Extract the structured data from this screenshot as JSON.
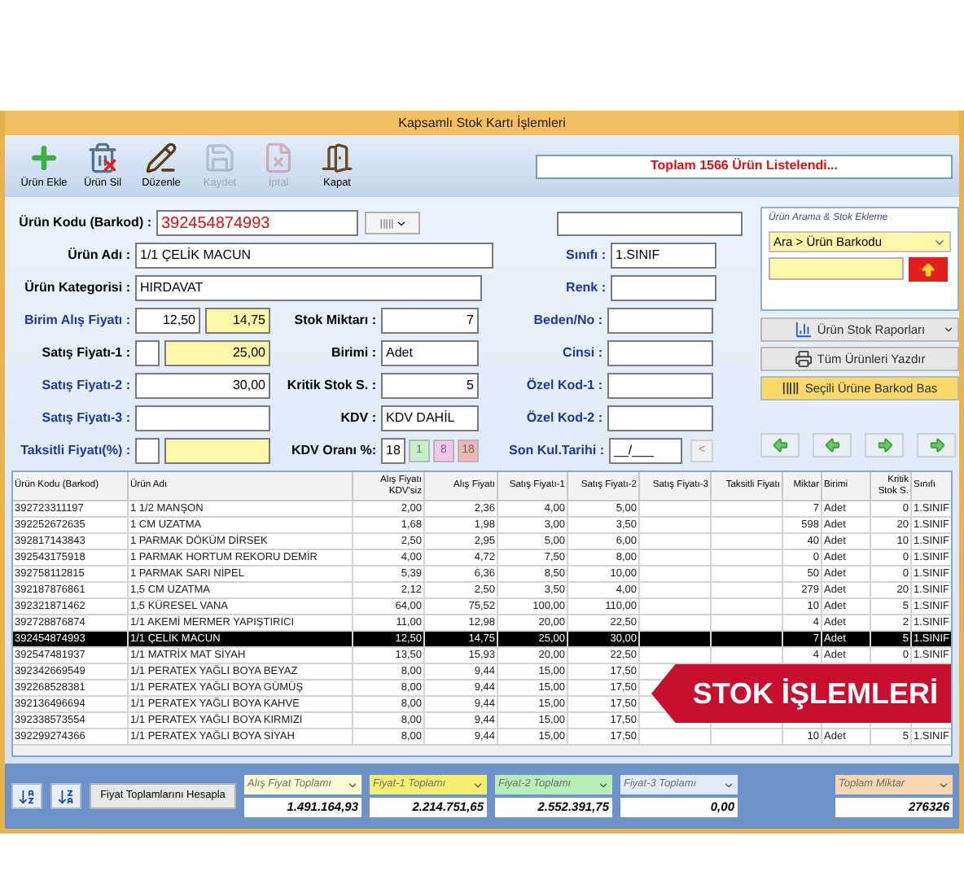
{
  "window": {
    "title": "Kapsamlı Stok Kartı İşlemleri"
  },
  "toolbar": [
    {
      "label": "Ürün Ekle",
      "kind": "add",
      "disabled": false
    },
    {
      "label": "Ürün Sil",
      "kind": "delete",
      "disabled": false
    },
    {
      "label": "Düzenle",
      "kind": "edit",
      "disabled": false
    },
    {
      "label": "Kaydet",
      "kind": "save",
      "disabled": true
    },
    {
      "label": "İptal",
      "kind": "cancel",
      "disabled": true
    },
    {
      "label": "Kapat",
      "kind": "close",
      "disabled": false
    }
  ],
  "status": "Toplam 1566 Ürün Listelendi...",
  "form": {
    "product_code": {
      "label": "Ürün Kodu (Barkod) :",
      "value": "392454874993",
      "color": "#000000"
    },
    "product_name": {
      "label": "Ürün Adı :",
      "value": "1/1 ÇELİK MACUN",
      "color": "#000000"
    },
    "category": {
      "label": "Ürün Kategorisi :",
      "value": "HIRDAVAT",
      "color": "#000000"
    },
    "purchase_price": {
      "label": "Birim Alış Fiyatı :",
      "value": "12,50",
      "value_with_vat": "14,75",
      "color": "#1f35a8"
    },
    "sale_price_1": {
      "label": "Satış Fiyatı-1 :",
      "value": "25,00",
      "color": "#000000"
    },
    "sale_price_2": {
      "label": "Satış Fiyatı-2 :",
      "value": "30,00",
      "color": "#1f35a8"
    },
    "sale_price_3": {
      "label": "Satış Fiyatı-3 :",
      "color": "#1f35a8"
    },
    "installment_price": {
      "label": "Taksitli Fiyatı(%) :",
      "color": "#1f35a8"
    },
    "stock_quantity": {
      "label": "Stok Miktarı :",
      "value": "7",
      "color": "#000000"
    },
    "unit": {
      "label": "Birimi :",
      "value": "Adet",
      "color": "#000000"
    },
    "critical_stock": {
      "label": "Kritik Stok S. :",
      "value": "5",
      "color": "#000000"
    },
    "vat": {
      "label": "KDV :",
      "value": "KDV DAHİL",
      "color": "#000000"
    },
    "vat_rate": {
      "label": "KDV Oranı %:",
      "value": "18",
      "options": [
        {
          "label": "1",
          "color": "#c6f0c6"
        },
        {
          "label": "8",
          "color": "#f2c6f0"
        },
        {
          "label": "18",
          "color": "#f2b4b4"
        }
      ],
      "color": "#000000"
    },
    "class": {
      "label": "Sınıfı :",
      "value": "1.SINIF",
      "color": "#1f35a8"
    },
    "colour": {
      "label": "Renk :",
      "color": "#1f35a8"
    },
    "size": {
      "label": "Beden/No :",
      "color": "#1f35a8"
    },
    "type": {
      "label": "Cinsi :",
      "color": "#1f35a8"
    },
    "special_code_1": {
      "label": "Özel Kod-1 :",
      "color": "#1f35a8"
    },
    "special_code_2": {
      "label": "Özel Kod-2 :",
      "color": "#1f35a8"
    },
    "expiry_date": {
      "label": "Son Kul.Tarihi :",
      "value": "__/___",
      "button": "<",
      "color": "#1f35a8"
    }
  },
  "search": {
    "title": "Ürün Arama & Stok Ekleme",
    "mode": "Ara > Ürün Barkodu"
  },
  "actions": [
    {
      "label": "Ürün Stok Raporları",
      "kind": "report"
    },
    {
      "label": "Tüm Ürünleri Yazdır",
      "kind": "print"
    },
    {
      "label": "Seçili Ürüne Barkod Bas",
      "kind": "barcode"
    }
  ],
  "table": {
    "columns": [
      "Ürün Kodu (Barkod)",
      "Ürün Adı",
      "Alış Fiyatı KDV'siz",
      "Alış Fiyatı",
      "Satış Fiyatı-1",
      "Satış Fiyatı-2",
      "Satış Fiyatı-3",
      "Taksitli Fiyatı",
      "Miktar",
      "Birimi",
      "Kritik Stok S.",
      "Sınıfı"
    ],
    "rows": [
      {
        "selected": false,
        "cells": [
          "392723311197",
          "1 1/2 MANŞON",
          "2,00",
          "2,36",
          "4,00",
          "5,00",
          null,
          null,
          "7",
          "Adet",
          "0",
          "1.SINIF"
        ]
      },
      {
        "selected": false,
        "cells": [
          "392252672635",
          "1 CM UZATMA",
          "1,68",
          "1,98",
          "3,00",
          "3,50",
          null,
          null,
          "598",
          "Adet",
          "20",
          "1.SINIF"
        ]
      },
      {
        "selected": false,
        "cells": [
          "392817143843",
          "1 PARMAK DÖKÜM DİRSEK",
          "2,50",
          "2,95",
          "5,00",
          "6,00",
          null,
          null,
          "40",
          "Adet",
          "10",
          "1.SINIF"
        ]
      },
      {
        "selected": false,
        "cells": [
          "392543175918",
          "1 PARMAK HORTUM REKORU DEMİR",
          "4,00",
          "4,72",
          "7,50",
          "8,00",
          null,
          null,
          "0",
          "Adet",
          "0",
          "1.SINIF"
        ]
      },
      {
        "selected": false,
        "cells": [
          "392758112815",
          "1 PARMAK SARI NİPEL",
          "5,39",
          "6,36",
          "8,50",
          "10,00",
          null,
          null,
          "50",
          "Adet",
          "0",
          "1.SINIF"
        ]
      },
      {
        "selected": false,
        "cells": [
          "392187876861",
          "1,5 CM UZATMA",
          "2,12",
          "2,50",
          "3,50",
          "4,00",
          null,
          null,
          "279",
          "Adet",
          "20",
          "1.SINIF"
        ]
      },
      {
        "selected": false,
        "cells": [
          "392321871462",
          "1,5 KÜRESEL VANA",
          "64,00",
          "75,52",
          "100,00",
          "110,00",
          null,
          null,
          "10",
          "Adet",
          "5",
          "1.SINIF"
        ]
      },
      {
        "selected": false,
        "cells": [
          "392728876874",
          "1/1 AKEMİ MERMER YAPIŞTIRICI",
          "11,00",
          "12,98",
          "20,00",
          "22,50",
          null,
          null,
          "4",
          "Adet",
          "2",
          "1.SINIF"
        ]
      },
      {
        "selected": true,
        "cells": [
          "392454874993",
          "1/1 ÇELİK MACUN",
          "12,50",
          "14,75",
          "25,00",
          "30,00",
          null,
          null,
          "7",
          "Adet",
          "5",
          "1.SINIF"
        ]
      },
      {
        "selected": false,
        "cells": [
          "392547481937",
          "1/1 MATRİX MAT SİYAH",
          "13,50",
          "15,93",
          "20,00",
          "22,50",
          null,
          null,
          "4",
          "Adet",
          "0",
          "1.SINIF"
        ]
      },
      {
        "selected": false,
        "cells": [
          "392342669549",
          "1/1 PERATEX YAĞLI BOYA BEYAZ",
          "8,00",
          "9,44",
          "15,00",
          "17,50",
          null,
          null,
          null,
          null,
          null,
          null
        ]
      },
      {
        "selected": false,
        "cells": [
          "392268528381",
          "1/1 PERATEX YAĞLI BOYA GÜMÜŞ",
          "8,00",
          "9,44",
          "15,00",
          "17,50",
          null,
          null,
          null,
          null,
          null,
          null
        ]
      },
      {
        "selected": false,
        "cells": [
          "392136496694",
          "1/1 PERATEX YAĞLI BOYA KAHVE",
          "8,00",
          "9,44",
          "15,00",
          "17,50",
          null,
          null,
          null,
          null,
          null,
          null
        ]
      },
      {
        "selected": false,
        "cells": [
          "392338573554",
          "1/1 PERATEX YAĞLI BOYA KIRMIZI",
          "8,00",
          "9,44",
          "15,00",
          "17,50",
          null,
          null,
          null,
          null,
          null,
          null
        ]
      },
      {
        "selected": false,
        "cells": [
          "392299274366",
          "1/1 PERATEX YAĞLI BOYA SİYAH",
          "8,00",
          "9,44",
          "15,00",
          "17,50",
          null,
          null,
          "10",
          "Adet",
          "5",
          "1.SINIF"
        ]
      }
    ]
  },
  "banner": {
    "text": "STOK İŞLEMLERİ"
  },
  "calculate_button": "Fiyat Toplamlarını Hesapla",
  "totals": [
    {
      "label": "Alış Fiyat Toplamı",
      "value": "1.491.164,93",
      "color": "#fbf8d2"
    },
    {
      "label": "Fiyat-1 Toplamı",
      "value": "2.214.751,65",
      "color": "#f6ee6e"
    },
    {
      "label": "Fiyat-2 Toplamı",
      "value": "2.552.391,75",
      "color": "#b6efb6"
    },
    {
      "label": "Fiyat-3 Toplamı",
      "value": "0,00",
      "color": "#e2ecf8"
    },
    {
      "label": "Toplam Miktar",
      "value": "276326",
      "color": "#f6d6ae"
    }
  ]
}
